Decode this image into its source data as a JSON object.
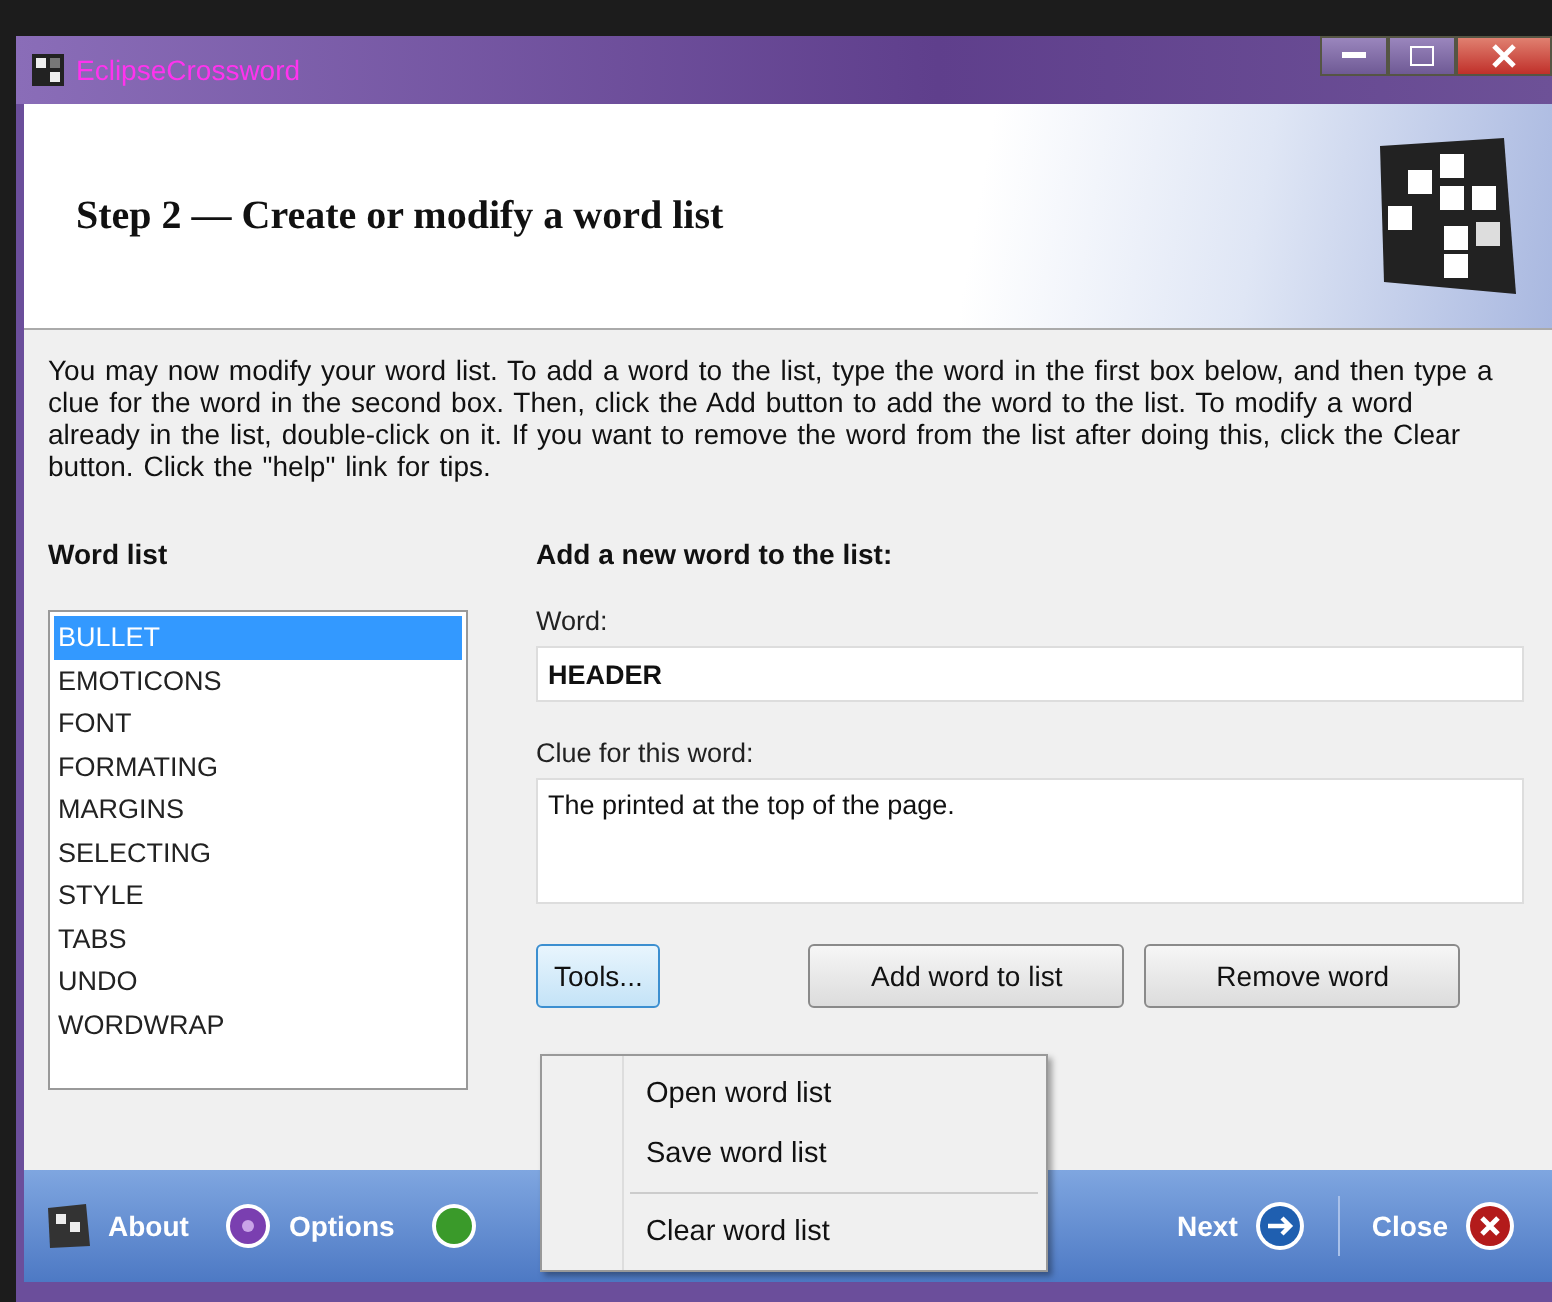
{
  "window": {
    "title": "EclipseCrossword"
  },
  "header": {
    "title": "Step 2 — Create or modify a word list"
  },
  "description": "You may now modify your word list.  To add a word to the list, type the word in the first box below, and then type a clue for the word in the second box.  Then, click the Add button to add the word to the list.  To modify a word already in the list, double-click on it.  If you want to remove the word from the list after doing this, click the Clear button.  Click the \"help\" link for tips.",
  "word_list": {
    "heading": "Word list",
    "items": [
      {
        "label": "BULLET",
        "selected": true
      },
      {
        "label": "EMOTICONS",
        "selected": false
      },
      {
        "label": "FONT",
        "selected": false
      },
      {
        "label": "FORMATING",
        "selected": false
      },
      {
        "label": "MARGINS",
        "selected": false
      },
      {
        "label": "SELECTING",
        "selected": false
      },
      {
        "label": "STYLE",
        "selected": false
      },
      {
        "label": "TABS",
        "selected": false
      },
      {
        "label": "UNDO",
        "selected": false
      },
      {
        "label": "WORDWRAP",
        "selected": false
      }
    ]
  },
  "editor": {
    "heading": "Add a new word to the list:",
    "word_label": "Word:",
    "word_value": "HEADER",
    "clue_label": "Clue for this word:",
    "clue_value": "The printed at the top of the page.",
    "buttons": [
      {
        "label": "Tools...",
        "kind": "tools"
      },
      {
        "label": "Add word to list",
        "kind": "plain"
      },
      {
        "label": "Remove word",
        "kind": "plain"
      }
    ]
  },
  "tools_menu": [
    {
      "label": "Open word list",
      "kind": "item"
    },
    {
      "label": "Save word list",
      "kind": "item"
    },
    {
      "kind": "separator"
    },
    {
      "label": "Clear word list",
      "kind": "item"
    }
  ],
  "footer": {
    "left": [
      {
        "label": "About",
        "kind": "about"
      },
      {
        "label": "Options",
        "kind": "options"
      },
      {
        "kind": "help"
      }
    ],
    "right": [
      {
        "label": "Next",
        "kind": "next"
      },
      {
        "label": "Close",
        "kind": "close"
      }
    ]
  }
}
